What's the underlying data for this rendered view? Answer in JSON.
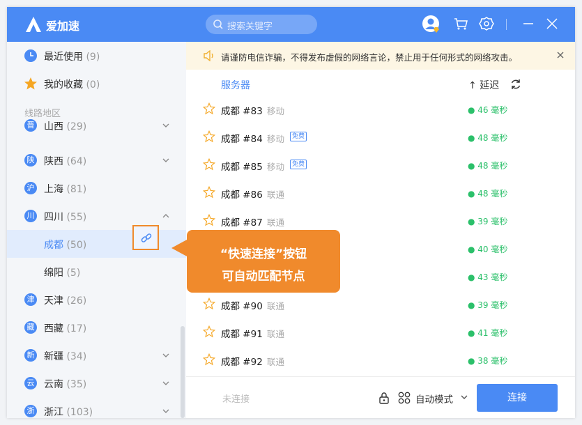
{
  "app": {
    "name": "爱加速"
  },
  "search": {
    "placeholder": "搜索关键字"
  },
  "colors": {
    "primary": "#4a8af4",
    "accent": "#f08a2c",
    "latency": "#2bc06a"
  },
  "sidebar": {
    "recent": {
      "label": "最近使用",
      "count": "(9)",
      "icon": "clock-icon"
    },
    "favorites": {
      "label": "我的收藏",
      "count": "(0)",
      "icon": "star-icon"
    },
    "section_title": "线路地区",
    "regions": [
      {
        "badge": "晋",
        "label": "山西",
        "count": "(29)"
      },
      {
        "badge": "陕",
        "label": "陕西",
        "count": "(64)"
      },
      {
        "badge": "沪",
        "label": "上海",
        "count": "(81)"
      },
      {
        "badge": "川",
        "label": "四川",
        "count": "(55)"
      },
      {
        "label": "成都",
        "count": "(50)"
      },
      {
        "label": "绵阳",
        "count": "(5)"
      },
      {
        "badge": "津",
        "label": "天津",
        "count": "(26)"
      },
      {
        "badge": "藏",
        "label": "西藏",
        "count": "(17)"
      },
      {
        "badge": "新",
        "label": "新疆",
        "count": "(34)"
      },
      {
        "badge": "云",
        "label": "云南",
        "count": "(35)"
      },
      {
        "badge": "浙",
        "label": "浙江",
        "count": "(103)"
      }
    ]
  },
  "notice": {
    "text": "请谨防电信诈骗，不得发布虚假的网络言论，禁止用于任何形式的网络攻击。"
  },
  "list": {
    "header_server": "服务器",
    "header_delay": "↑ 延迟",
    "rows": [
      {
        "name": "成都 #83",
        "isp": "移动",
        "free": "",
        "latency": "● 46 毫秒"
      },
      {
        "name": "成都 #84",
        "isp": "移动",
        "free": "免费",
        "latency": "● 48 毫秒"
      },
      {
        "name": "成都 #85",
        "isp": "移动",
        "free": "免费",
        "latency": "● 48 毫秒"
      },
      {
        "name": "成都 #86",
        "isp": "联通",
        "free": "",
        "latency": "● 48 毫秒"
      },
      {
        "name": "成都 #87",
        "isp": "联通",
        "free": "",
        "latency": "● 39 毫秒"
      },
      {
        "name": "",
        "isp": "",
        "free": "",
        "latency": "● 40 毫秒"
      },
      {
        "name": "",
        "isp": "",
        "free": "",
        "latency": "● 43 毫秒"
      },
      {
        "name": "成都 #90",
        "isp": "联通",
        "free": "",
        "latency": "● 39 毫秒"
      },
      {
        "name": "成都 #91",
        "isp": "联通",
        "free": "",
        "latency": "● 41 毫秒"
      },
      {
        "name": "成都 #92",
        "isp": "联通",
        "free": "",
        "latency": "● 38 毫秒"
      }
    ]
  },
  "bottom": {
    "status": "未连接",
    "mode": "自动模式",
    "connect": "连接"
  },
  "callout": {
    "line1": "“快速连接”按钮",
    "line2": "可自动匹配节点"
  }
}
